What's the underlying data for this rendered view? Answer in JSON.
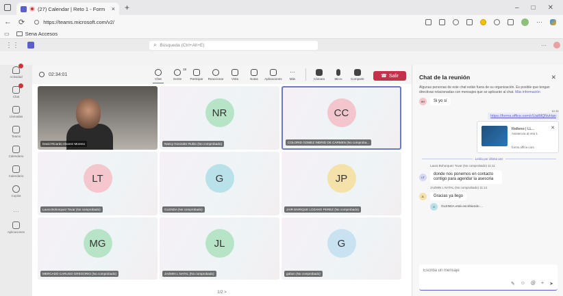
{
  "browser": {
    "tab_title": "(27) Calendar | Reto 1 - Form",
    "tab_close": "×",
    "new_tab": "+",
    "url": "https://teams.microsoft.com/v2/",
    "favorites_folder": "Sena Accesos",
    "controls": [
      "–",
      "□",
      "✕"
    ]
  },
  "teams": {
    "search_placeholder": "Búsqueda (Ctrl+Alt+E)",
    "more": "···"
  },
  "rail": {
    "items": [
      {
        "label": "Actividad",
        "badge": true
      },
      {
        "label": "Chat",
        "badge": true
      },
      {
        "label": "Llamadas",
        "badge": false
      },
      {
        "label": "Teams",
        "badge": false
      },
      {
        "label": "Calendario",
        "badge": false
      },
      {
        "label": "Calendario",
        "badge": false
      },
      {
        "label": "Copilot",
        "badge": false
      }
    ],
    "more": "···",
    "apps_label": "Aplicaciones"
  },
  "meeting": {
    "timer": "02:34:01",
    "controls": [
      {
        "id": "chat",
        "label": "Chat"
      },
      {
        "id": "people",
        "label": "Gente",
        "count": "18"
      },
      {
        "id": "participants",
        "label": "Participar"
      },
      {
        "id": "react",
        "label": "Reaccionar"
      },
      {
        "id": "view",
        "label": "Vista"
      },
      {
        "id": "notes",
        "label": "Notas"
      },
      {
        "id": "apps",
        "label": "Aplicaciones"
      },
      {
        "id": "more",
        "label": "Más"
      },
      {
        "id": "camera",
        "label": "Cámara"
      },
      {
        "id": "mic",
        "label": "Micro"
      },
      {
        "id": "share",
        "label": "Compartir"
      }
    ],
    "leave_label": "Salir",
    "pager": "1/2 >",
    "tiles": [
      {
        "initials": "",
        "name": "David Ricardo Alvarez Moreno",
        "video": true,
        "color": ""
      },
      {
        "initials": "NR",
        "name": "Nancy Gonzalez Rubio (No comprobado)",
        "video": false,
        "color": "#b7e4c7"
      },
      {
        "initials": "CC",
        "name": "COLORID GOMEZ INDRID DE CARMEN (No comproba...",
        "video": false,
        "color": "#f2c6cc",
        "selected": true
      },
      {
        "initials": "LT",
        "name": "Laura Bohorquez Tovar (No comprobado)",
        "video": false,
        "color": "#f3c7cb"
      },
      {
        "initials": "G",
        "name": "GLENDA (No comprobado)",
        "video": false,
        "color": "#b9e1ea"
      },
      {
        "initials": "JP",
        "name": "JAIR ENRIQUE LOZANO PEREZ (No comprobado)",
        "video": false,
        "color": "#f4e2a9"
      },
      {
        "initials": "MG",
        "name": "MERCADO CARUSO GREGORIO (No comprobado)",
        "video": false,
        "color": "#b7e4c7"
      },
      {
        "initials": "JL",
        "name": "JAZMIN L NATAL (No comprobado)",
        "video": false,
        "color": "#b7e4c7"
      },
      {
        "initials": "G",
        "name": "gabon (No comprobado)",
        "video": false,
        "color": "#c9e2f1"
      }
    ]
  },
  "chat": {
    "title": "Chat de la reunión",
    "close": "✕",
    "notice": "Algunas personas de este chat están fuera de su organización. Es posible que tengan directivas relacionadas con mensajes que se aplicarán al chat.",
    "notice_link": "Más información",
    "msg1": {
      "avatar": "AH",
      "text": "Si yo sí"
    },
    "time1": "11:11",
    "link_text": "https://forms.office.com/r/UatMQNvHan",
    "card": {
      "title": "Relleno | LL...",
      "subtitle": "Asistencia al reto 1",
      "domain": "forms.office.com",
      "close": "✕"
    },
    "read_label": "Leído por última vez",
    "sender2": "Laura Bohorquez Tovar (No comprobado)  11:11",
    "msg2": {
      "avatar": "LT",
      "text": "donde nos ponemos en contacto contigo para agendar la asesoria"
    },
    "sender3": "JAZMIN L NATAL (No comprobado)  11:12",
    "msg3": {
      "avatar": "JL",
      "text": "Gracias ya llego"
    },
    "typing": {
      "avatar": "G",
      "text": "GLENDA está escribiendo ..."
    },
    "compose_placeholder": "Escriba un mensaje",
    "compose_tools": [
      "✎",
      "☺",
      "@",
      "+",
      "➤"
    ]
  }
}
